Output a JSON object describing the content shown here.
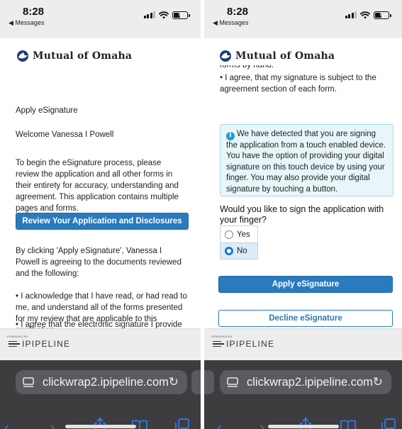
{
  "left": {
    "status_time": "8:28",
    "back_app": "◀ Messages",
    "battery": "5",
    "brand": "Mutual of Omaha",
    "heading": "Apply eSignature",
    "welcome": "Welcome Vanessa I Powell",
    "intro": "To begin the eSignature process, please review the application and all other forms in their entirety for accuracy, understanding and agreement. This application contains multiple pages and forms.",
    "review_button": "Review Your Application and Disclosures",
    "consent": "By clicking 'Apply eSignature', Vanessa I Powell is agreeing to the documents reviewed and the following:",
    "bullet1": "• I acknowledge that I have read, or had read to me, and understand all of the forms presented for my review that are applicable to this application.",
    "bullet2": "• I agree that the electronic signature I provide",
    "powered_by": "POWERED BY",
    "ipipeline": "IPIPELINE",
    "url": "clickwrap2.ipipeline.com"
  },
  "right": {
    "status_time": "8:28",
    "back_app": "◀ Messages",
    "battery": "5",
    "brand": "Mutual of Omaha",
    "partial_line": "forms by hand.",
    "bullet": "• I agree, that my signature is subject to the agreement section of each form.",
    "info_text": "We have detected that you are signing the application from a touch enabled device. You have the option of providing your digital signature on this touch device by using your finger. You may also provide your digital signature by touching a button.",
    "question": "Would you like to sign the application with your finger?",
    "option_yes": "Yes",
    "option_no": "No",
    "selected_option": "No",
    "apply_button": "Apply eSignature",
    "decline_button": "Decline eSignature",
    "powered_by": "POWERED BY",
    "ipipeline": "IPIPELINE",
    "url": "clickwrap2.ipipeline.com"
  },
  "colors": {
    "primary_button": "#2a7bbd",
    "info_box": "#e8f6f9",
    "browser_bar": "#3d3d40",
    "toolbar_accent": "#2f7cf6"
  },
  "icons": [
    "signal-icon",
    "wifi-icon",
    "battery-icon",
    "brand-logo-icon",
    "info-icon",
    "tabs-icon",
    "reload-icon",
    "back-icon",
    "forward-icon",
    "share-icon",
    "bookmarks-icon",
    "tab-switcher-icon"
  ]
}
